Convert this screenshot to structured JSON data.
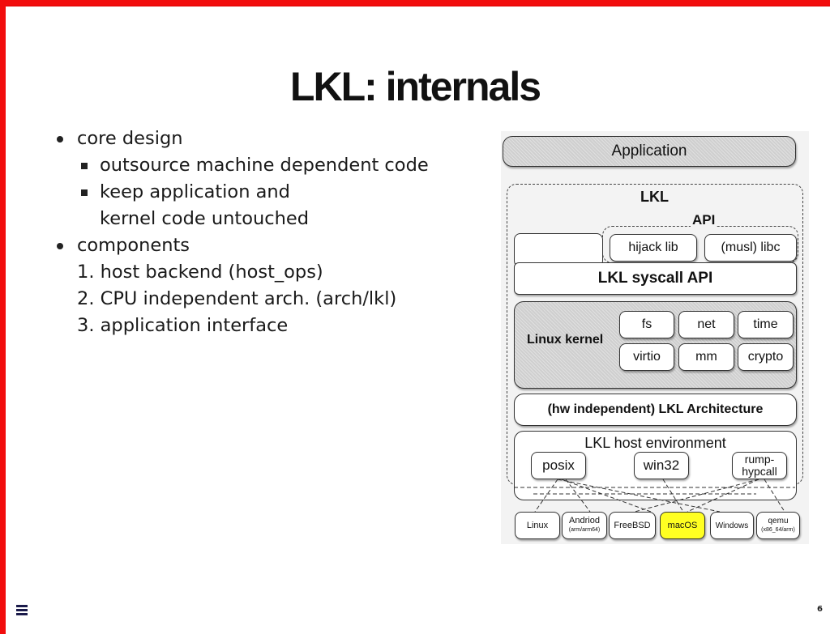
{
  "slide": {
    "title": "LKL: internals",
    "page_number": "6",
    "accent_color": "#f20d0d",
    "menu_icon": "hamburger-menu-icon"
  },
  "bullets": [
    {
      "level": 1,
      "marker": "disc",
      "text": "core design"
    },
    {
      "level": 2,
      "marker": "square",
      "text": "outsource machine dependent code"
    },
    {
      "level": 2,
      "marker": "square",
      "text": "keep application and"
    },
    {
      "level": 2,
      "marker": "none",
      "text": "kernel code untouched"
    },
    {
      "level": 1,
      "marker": "disc",
      "text": "components"
    },
    {
      "level": 2,
      "marker": "number",
      "text": "1. host backend (host_ops)"
    },
    {
      "level": 2,
      "marker": "number",
      "text": "2. CPU independent arch. (arch/lkl)"
    },
    {
      "level": 2,
      "marker": "number",
      "text": "3. application interface"
    }
  ],
  "diagram": {
    "application": "Application",
    "lkl_group": "LKL",
    "api_group": "API",
    "hijack_lib": "hijack lib",
    "libc": "(musl) libc",
    "syscall_api": "LKL syscall API",
    "linux_kernel": "Linux kernel",
    "subsystems": [
      "fs",
      "net",
      "time",
      "virtio",
      "mm",
      "crypto"
    ],
    "architecture": "(hw independent) LKL Architecture",
    "host_environment": "LKL host environment",
    "backends": [
      "posix",
      "win32",
      "rump-",
      "hypcall"
    ],
    "platforms": [
      {
        "name": "Linux",
        "sub": ""
      },
      {
        "name": "Andriod",
        "sub": "(arm/arm64)"
      },
      {
        "name": "FreeBSD",
        "sub": ""
      },
      {
        "name": "macOS",
        "sub": "",
        "highlight": "#ffff22"
      },
      {
        "name": "Windows",
        "sub": ""
      },
      {
        "name": "qemu",
        "sub": "(x86_64/arm)"
      }
    ]
  }
}
